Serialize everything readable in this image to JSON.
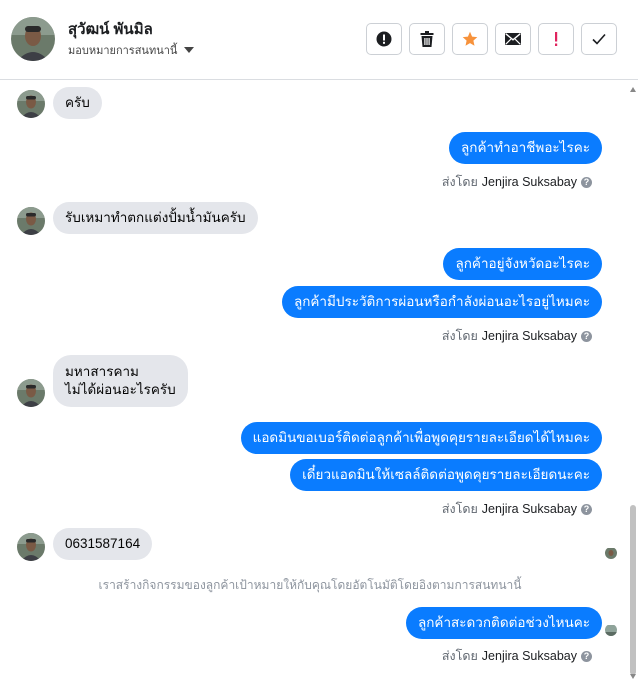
{
  "header": {
    "name": "สุวัฒน์ พันมิล",
    "assign_label": "มอบหมายการสนทนานี้",
    "actions": [
      "alert-icon",
      "trash-icon",
      "star-icon",
      "envelope-icon",
      "exclamation-icon",
      "check-icon"
    ],
    "star_color": "#f7923b",
    "exclamation_color": "#e0245e"
  },
  "messages": {
    "m1": "ครับ",
    "m2": "ลูกค้าทำอาชีพอะไรคะ",
    "m3": "รับเหมาทำตกแต่งปั้มน้ำมันครับ",
    "m4": "ลูกค้าอยู่จังหวัดอะไรคะ",
    "m5": "ลูกค้ามีประวัติการผ่อนหรือกำลังผ่อนอะไรอยู่ไหมคะ",
    "m6_line1": "มหาสารคาม",
    "m6_line2": "ไม่ได้ผ่อนอะไรครับ",
    "m7": "แอดมินขอเบอร์ติดต่อลูกค้าเพื่อพูดคุยรายละเอียดได้ไหมคะ",
    "m8": "เดี๋ยวแอดมินให้เซลล์ติดต่อพูดคุยรายละเอียดนะคะ",
    "m9": "0631587164",
    "m10": "ลูกค้าสะดวกติดต่อช่วงไหนคะ"
  },
  "sent_by": {
    "prefix": "ส่งโดย",
    "name": "Jenjira Suksabay"
  },
  "system_note": "เราสร้างกิจกรรมของลูกค้าเป้าหมายให้กับคุณโดยอัตโนมัติโดยอิงตามการสนทนานี้",
  "colors": {
    "outgoing_bubble": "#0a7cff",
    "incoming_bubble": "#e4e6eb"
  }
}
